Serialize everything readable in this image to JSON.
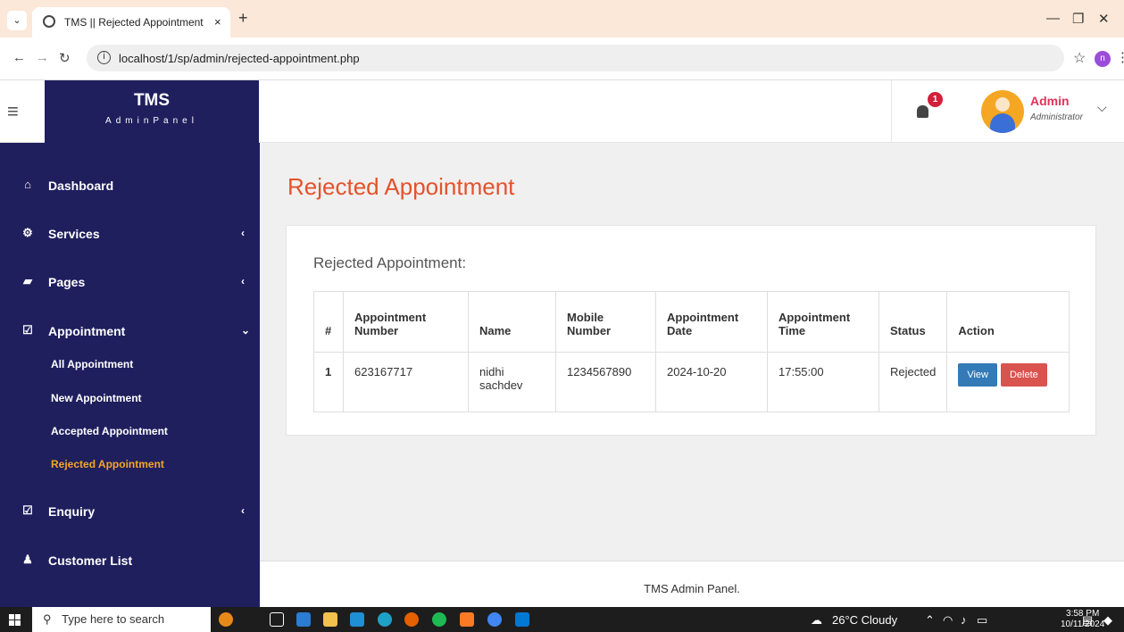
{
  "browser": {
    "tab_title": "TMS || Rejected Appointment",
    "tab_close": "×",
    "new_tab": "+",
    "url": "localhost/1/sp/admin/rejected-appointment.php",
    "info_icon": "i",
    "profile_initial": "n"
  },
  "header": {
    "brand_name": "TMS",
    "brand_sub": "AdminPanel",
    "notification_count": "1",
    "user_name": "Admin",
    "user_role": "Administrator"
  },
  "sidebar": {
    "items": [
      {
        "label": "Dashboard",
        "icon": "home-icon"
      },
      {
        "label": "Services",
        "icon": "cogs-icon"
      },
      {
        "label": "Pages",
        "icon": "book-icon"
      },
      {
        "label": "Appointment",
        "icon": "check-square-icon"
      },
      {
        "label": "Enquiry",
        "icon": "check-square-icon"
      },
      {
        "label": "Customer List",
        "icon": "users-icon"
      }
    ],
    "sub_items": [
      "All Appointment",
      "New Appointment",
      "Accepted Appointment",
      "Rejected Appointment"
    ],
    "active_sub": "Rejected Appointment"
  },
  "main": {
    "page_title": "Rejected Appointment",
    "card_title": "Rejected Appointment:",
    "table": {
      "headers": [
        "#",
        "Appointment Number",
        "Name",
        "Mobile Number",
        "Appointment Date",
        "Appointment Time",
        "Status",
        "Action"
      ],
      "rows": [
        {
          "num": "1",
          "appointment_number": "623167717",
          "name": "nidhi sachdev",
          "mobile": "1234567890",
          "date": "2024-10-20",
          "time": "17:55:00",
          "status": "Rejected"
        }
      ],
      "view_label": "View",
      "delete_label": "Delete"
    }
  },
  "footer": {
    "text": "TMS Admin Panel."
  },
  "taskbar": {
    "search_placeholder": "Type here to search",
    "weather": "26°C  Cloudy",
    "time": "3:58 PM",
    "date": "10/11/2024"
  },
  "colors": {
    "sidebar_bg": "#1f1f5e",
    "title_accent": "#e4522b",
    "active_link": "#f5a623",
    "view_btn": "#337ab7",
    "delete_btn": "#d9534f"
  }
}
